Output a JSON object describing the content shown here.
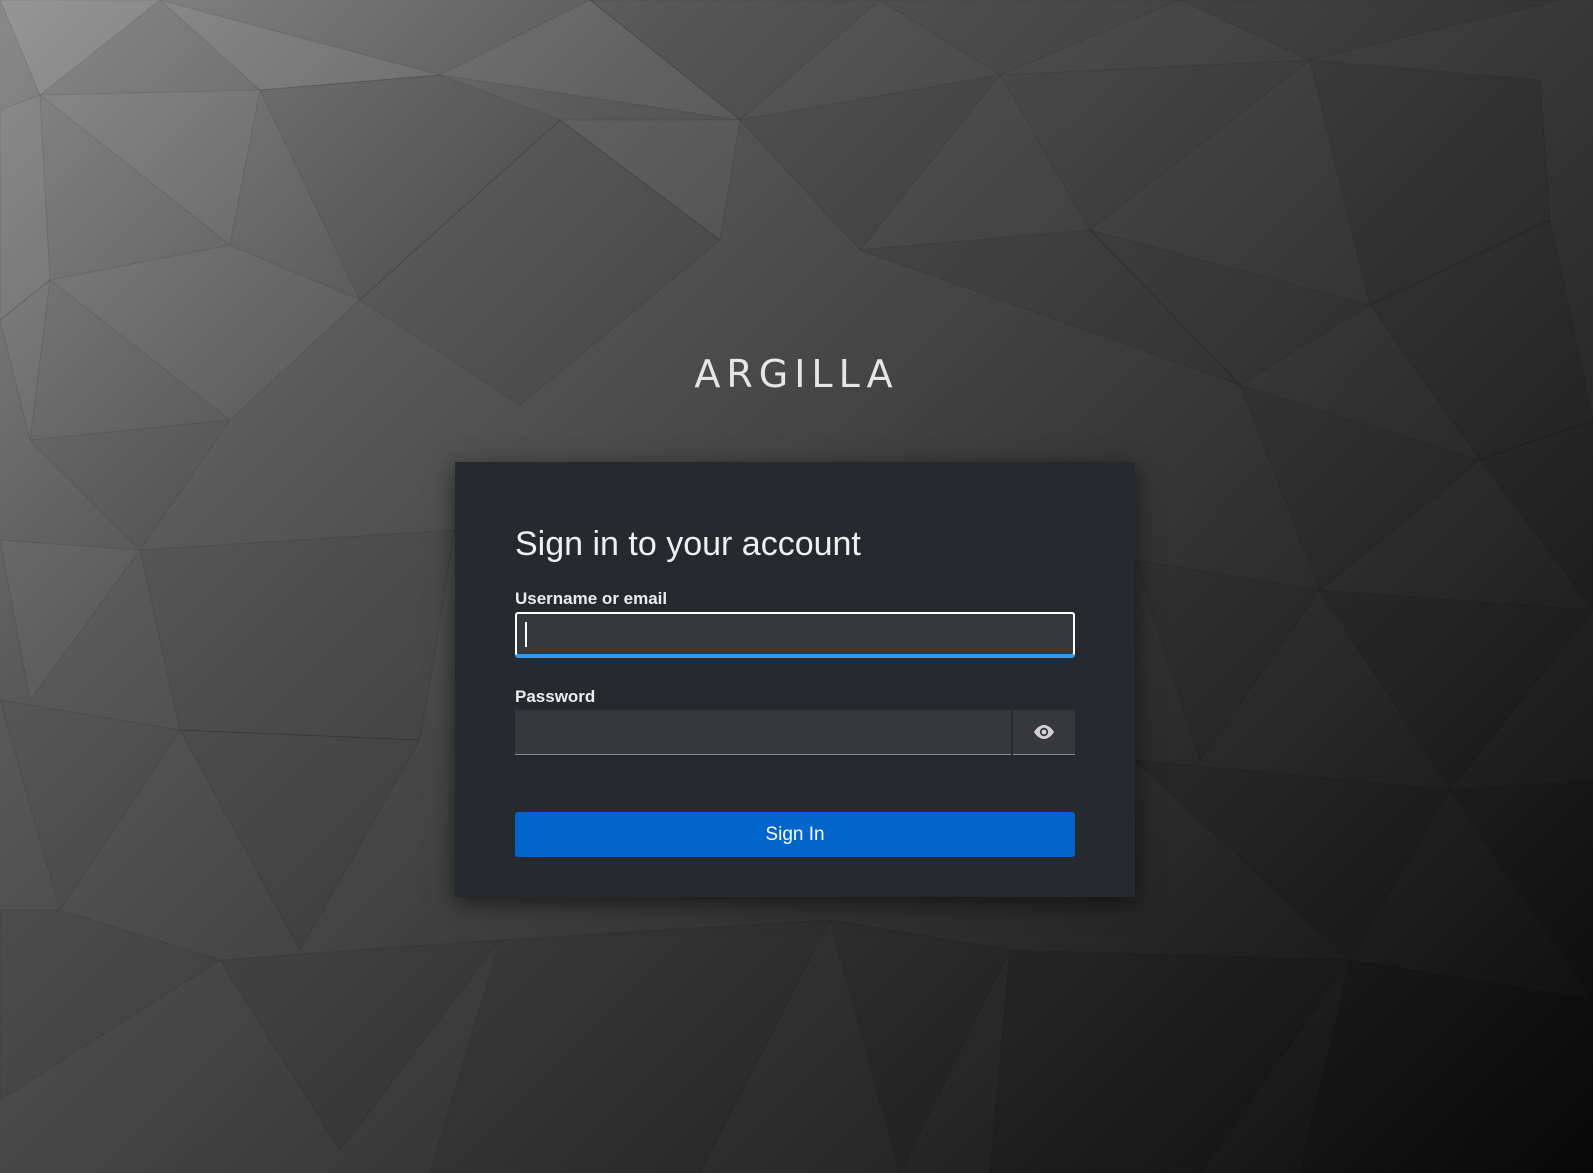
{
  "brand": {
    "name": "ARGILLA"
  },
  "login": {
    "title": "Sign in to your account",
    "username": {
      "label": "Username or email",
      "value": "",
      "placeholder": ""
    },
    "password": {
      "label": "Password",
      "value": "",
      "placeholder": "",
      "toggle_icon": "eye-icon"
    },
    "submit_label": "Sign In"
  },
  "colors": {
    "card_background": "#26292d",
    "input_background": "#36383c",
    "primary_button": "#0066cc",
    "focus_underline": "#2b9af3"
  }
}
